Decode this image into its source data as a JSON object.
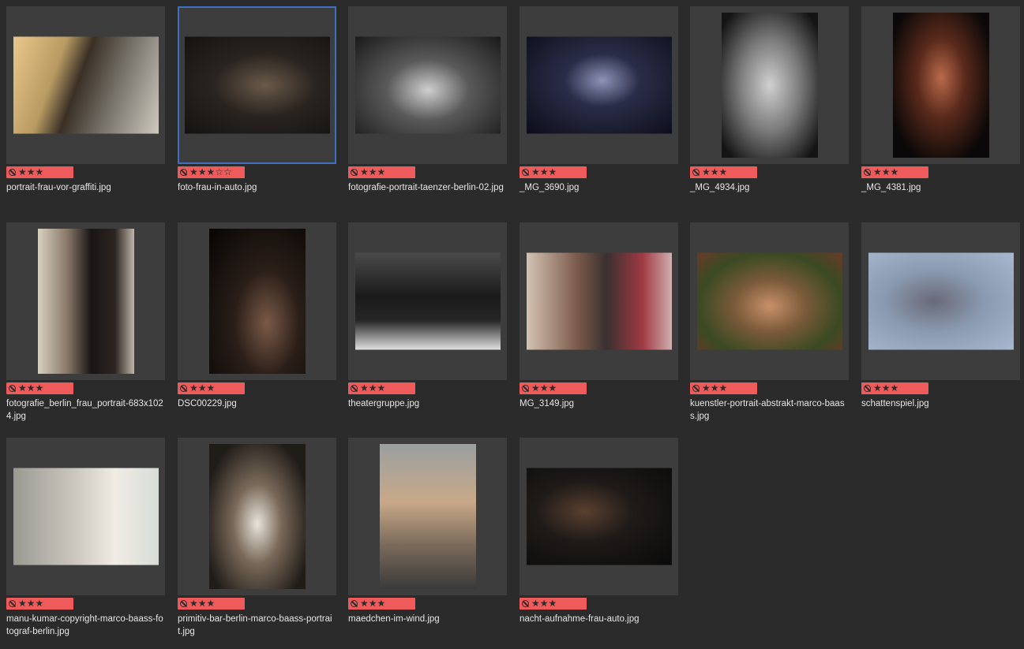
{
  "colors": {
    "background": "#2b2b2b",
    "thumb_frame": "#3d3d3d",
    "selection": "#3f6fc0",
    "rating_badge": "#ef5b5b"
  },
  "rating_icon": "reject-icon",
  "photos": [
    {
      "filename": "portrait-frau-vor-graffiti.jpg",
      "stars": "★★★",
      "selected": false
    },
    {
      "filename": "foto-frau-in-auto.jpg",
      "stars": "★★★☆☆",
      "selected": true
    },
    {
      "filename": "fotografie-portrait-taenzer-berlin-02.jpg",
      "stars": "★★★",
      "selected": false
    },
    {
      "filename": "_MG_3690.jpg",
      "stars": "★★★",
      "selected": false
    },
    {
      "filename": "_MG_4934.jpg",
      "stars": "★★★",
      "selected": false
    },
    {
      "filename": "_MG_4381.jpg",
      "stars": "★★★",
      "selected": false
    },
    {
      "filename": "fotografie_berlin_frau_portrait-683x1024.jpg",
      "stars": "★★★",
      "selected": false
    },
    {
      "filename": "DSC00229.jpg",
      "stars": "★★★",
      "selected": false
    },
    {
      "filename": "theatergruppe.jpg",
      "stars": "★★★",
      "selected": false
    },
    {
      "filename": "MG_3149.jpg",
      "stars": "★★★",
      "selected": false
    },
    {
      "filename": "kuenstler-portrait-abstrakt-marco-baass.jpg",
      "stars": "★★★",
      "selected": false
    },
    {
      "filename": "schattenspiel.jpg",
      "stars": "★★★",
      "selected": false
    },
    {
      "filename": "manu-kumar-copyright-marco-baass-fotograf-berlin.jpg",
      "stars": "★★★",
      "selected": false
    },
    {
      "filename": "primitiv-bar-berlin-marco-baass-portrait.jpg",
      "stars": "★★★",
      "selected": false
    },
    {
      "filename": "maedchen-im-wind.jpg",
      "stars": "★★★",
      "selected": false
    },
    {
      "filename": "nacht-aufnahme-frau-auto.jpg",
      "stars": "★★★",
      "selected": false
    }
  ]
}
